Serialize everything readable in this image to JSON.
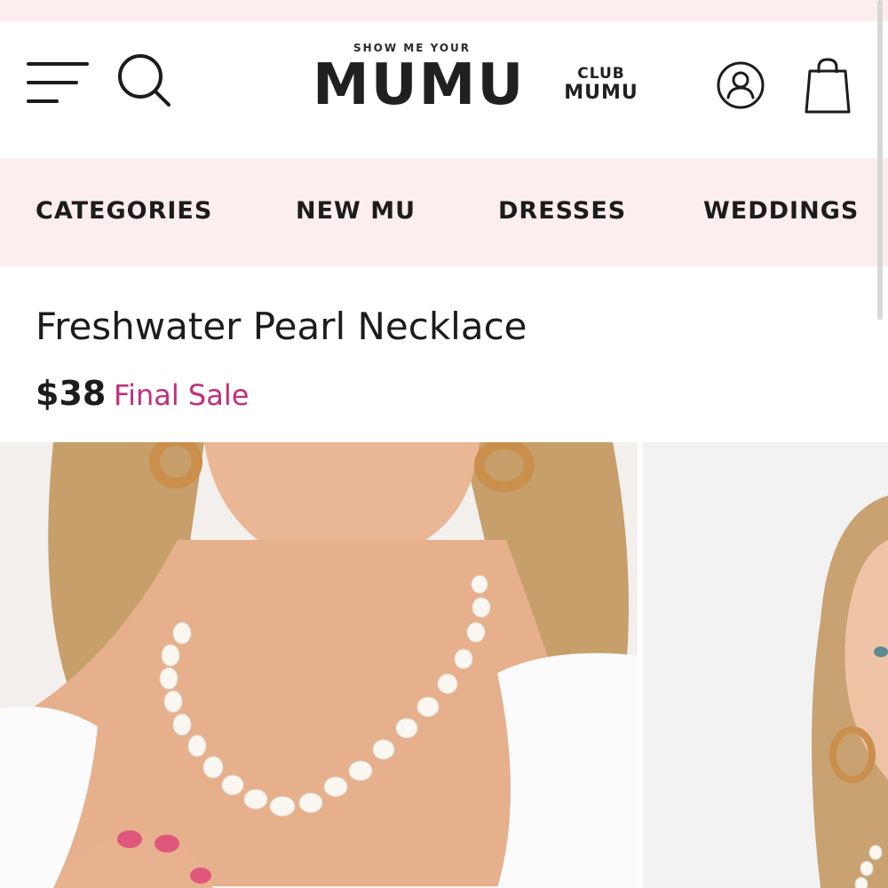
{
  "header": {
    "brand_tagline": "SHOW ME YOUR",
    "brand_name": "MUMU",
    "club_top": "CLUB",
    "club_bottom": "MUMU",
    "icons": [
      "menu-icon",
      "search-icon",
      "account-icon",
      "shopping-bag-icon"
    ]
  },
  "nav": {
    "items": [
      {
        "label": "CATEGORIES"
      },
      {
        "label": "NEW MU"
      },
      {
        "label": "DRESSES"
      },
      {
        "label": "WEDDINGS"
      }
    ]
  },
  "product": {
    "title": "Freshwater Pearl Necklace",
    "price": "$38",
    "sale_label": "Final Sale"
  },
  "colors": {
    "nav_background": "#fceeee",
    "sale_accent": "#c0307a",
    "text": "#1c1c1c"
  }
}
